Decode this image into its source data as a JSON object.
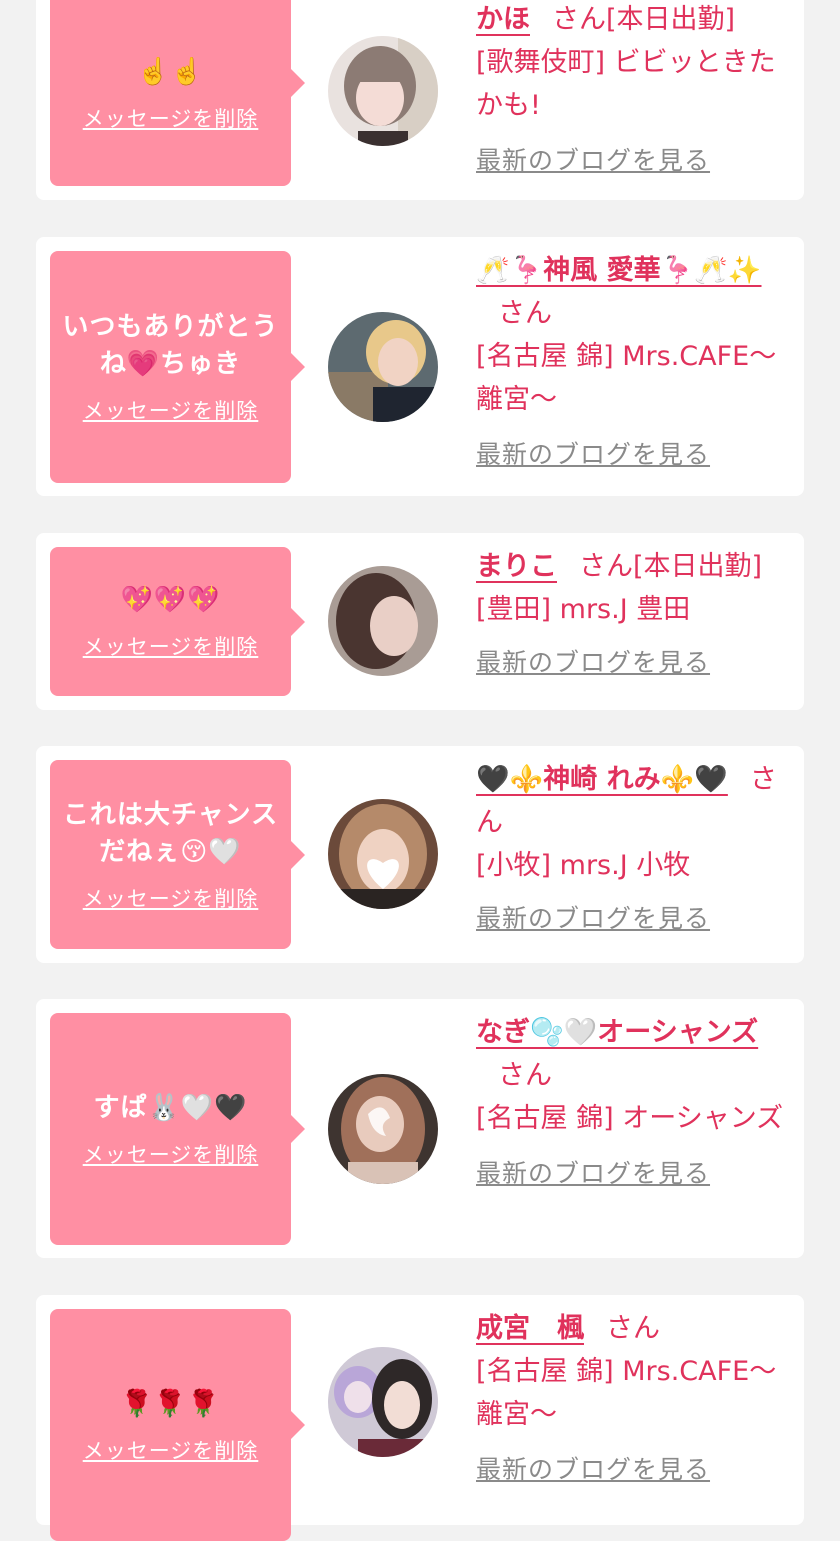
{
  "cards": [
    {
      "message": "☝️☝️",
      "delete_label": "メッセージを削除",
      "name": "かほ",
      "honorific": "さん",
      "status": "[本日出勤]",
      "shop": "[歌舞伎町] ビビッときたかも!",
      "blog_label": "最新のブログを見る"
    },
    {
      "message": "いつもありがとうね💗ちゅき",
      "delete_label": "メッセージを削除",
      "name": "🥂🦩神風 愛華🦩🥂✨",
      "honorific": "さん",
      "status": "",
      "shop": "[名古屋 錦] Mrs.CAFE〜離宮〜",
      "blog_label": "最新のブログを見る"
    },
    {
      "message": "💖💖💖",
      "delete_label": "メッセージを削除",
      "name": "まりこ",
      "honorific": "さん",
      "status": "[本日出勤]",
      "shop": "[豊田] mrs.J 豊田",
      "blog_label": "最新のブログを見る"
    },
    {
      "message": "これは大チャンスだねぇ😚🤍",
      "delete_label": "メッセージを削除",
      "name": "🖤⚜️神崎 れみ⚜️🖤",
      "honorific": "さん",
      "status": "",
      "shop": "[小牧] mrs.J 小牧",
      "blog_label": "最新のブログを見る"
    },
    {
      "message": "すぱ🐰🤍🖤",
      "delete_label": "メッセージを削除",
      "name": "なぎ🫧🤍オーシャンズ",
      "honorific": "さん",
      "status": "",
      "shop": "[名古屋 錦] オーシャンズ",
      "blog_label": "最新のブログを見る"
    },
    {
      "message": "🌹🌹🌹",
      "delete_label": "メッセージを削除",
      "name": "成宮　楓",
      "honorific": "さん",
      "status": "",
      "shop": "[名古屋 錦] Mrs.CAFE〜離宮〜",
      "blog_label": "最新のブログを見る"
    }
  ],
  "colors": {
    "page_bg": "#f2f2f2",
    "card_bg": "#ffffff",
    "bubble_bg": "#ff8fa3",
    "accent_text": "#e0325c",
    "link_gray": "#8a8a8a"
  }
}
